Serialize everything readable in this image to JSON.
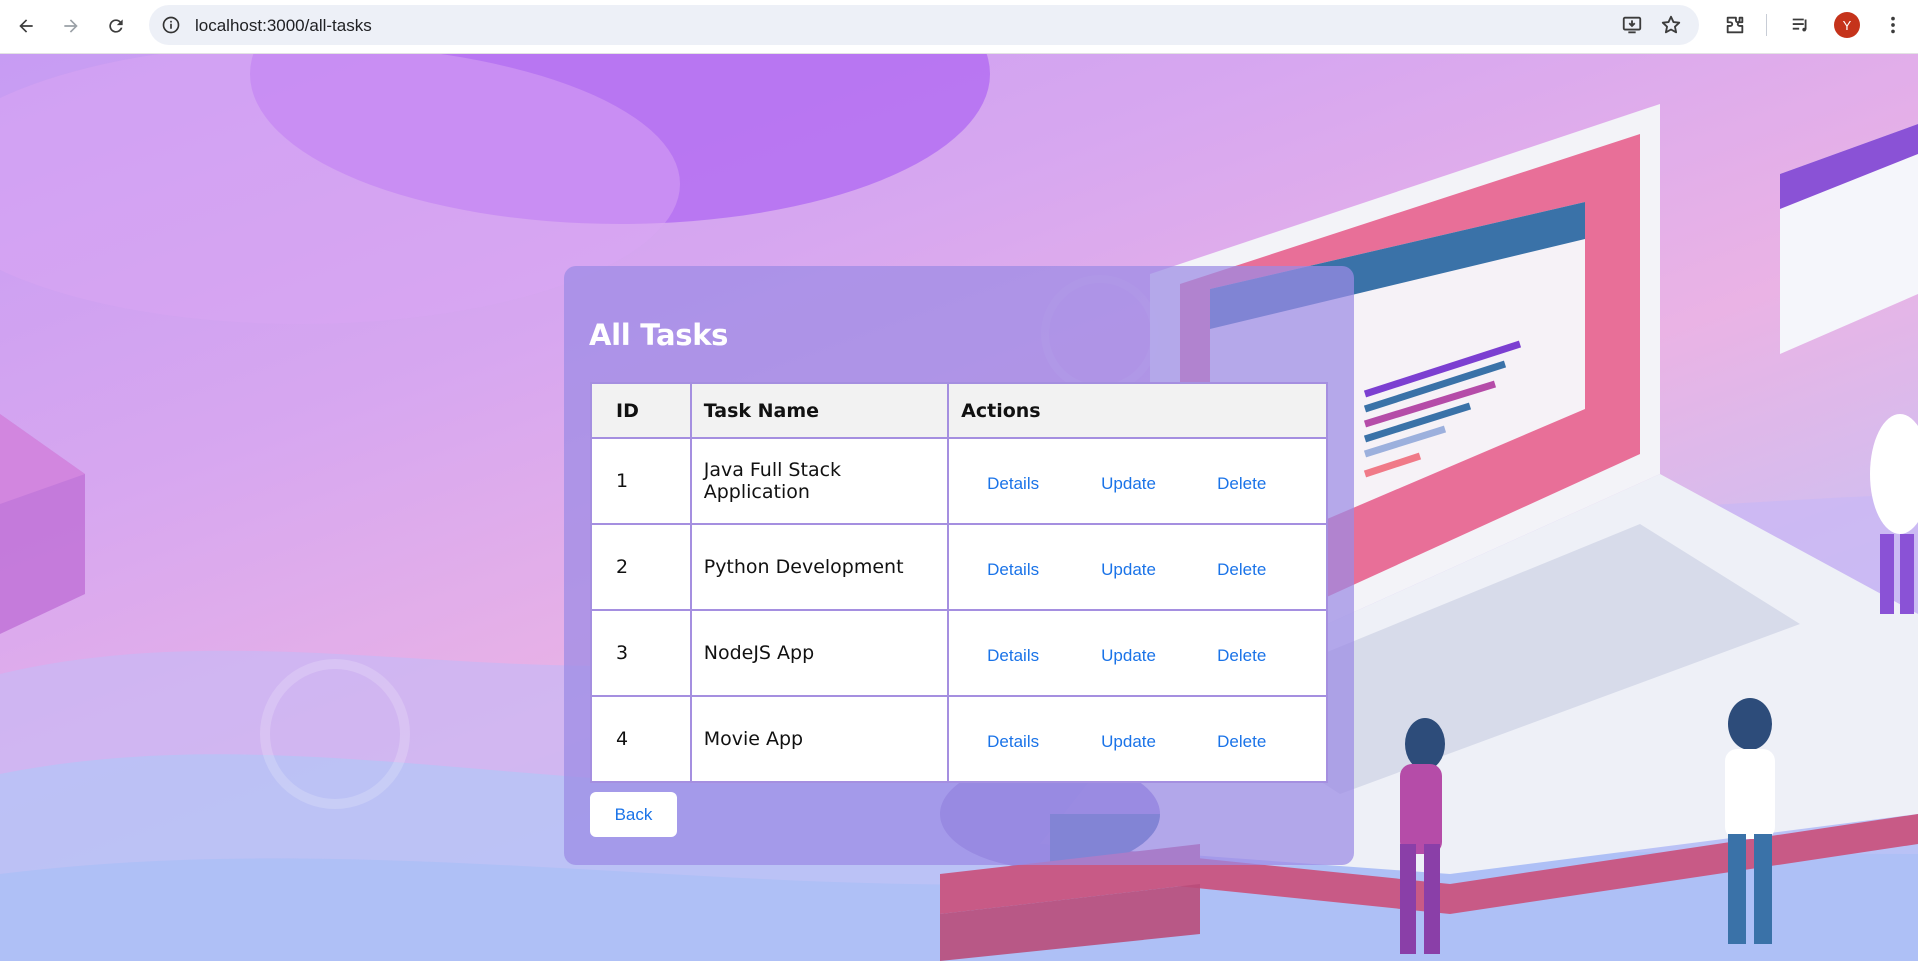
{
  "browser": {
    "url": "localhost:3000/all-tasks",
    "profile_initial": "Y",
    "profile_color": "#c5331b"
  },
  "panel": {
    "title": "All Tasks",
    "columns": [
      "ID",
      "Task Name",
      "Actions"
    ],
    "tasks": [
      {
        "id": "1",
        "name": "Java Full Stack Application"
      },
      {
        "id": "2",
        "name": "Python Development"
      },
      {
        "id": "3",
        "name": "NodeJS App"
      },
      {
        "id": "4",
        "name": "Movie App"
      }
    ],
    "actions": {
      "details": "Details",
      "update": "Update",
      "delete": "Delete"
    },
    "back_label": "Back"
  },
  "colors": {
    "link": "#1a73e8",
    "panel": "#9b8ae4",
    "header_bg": "#f2f2f2"
  }
}
